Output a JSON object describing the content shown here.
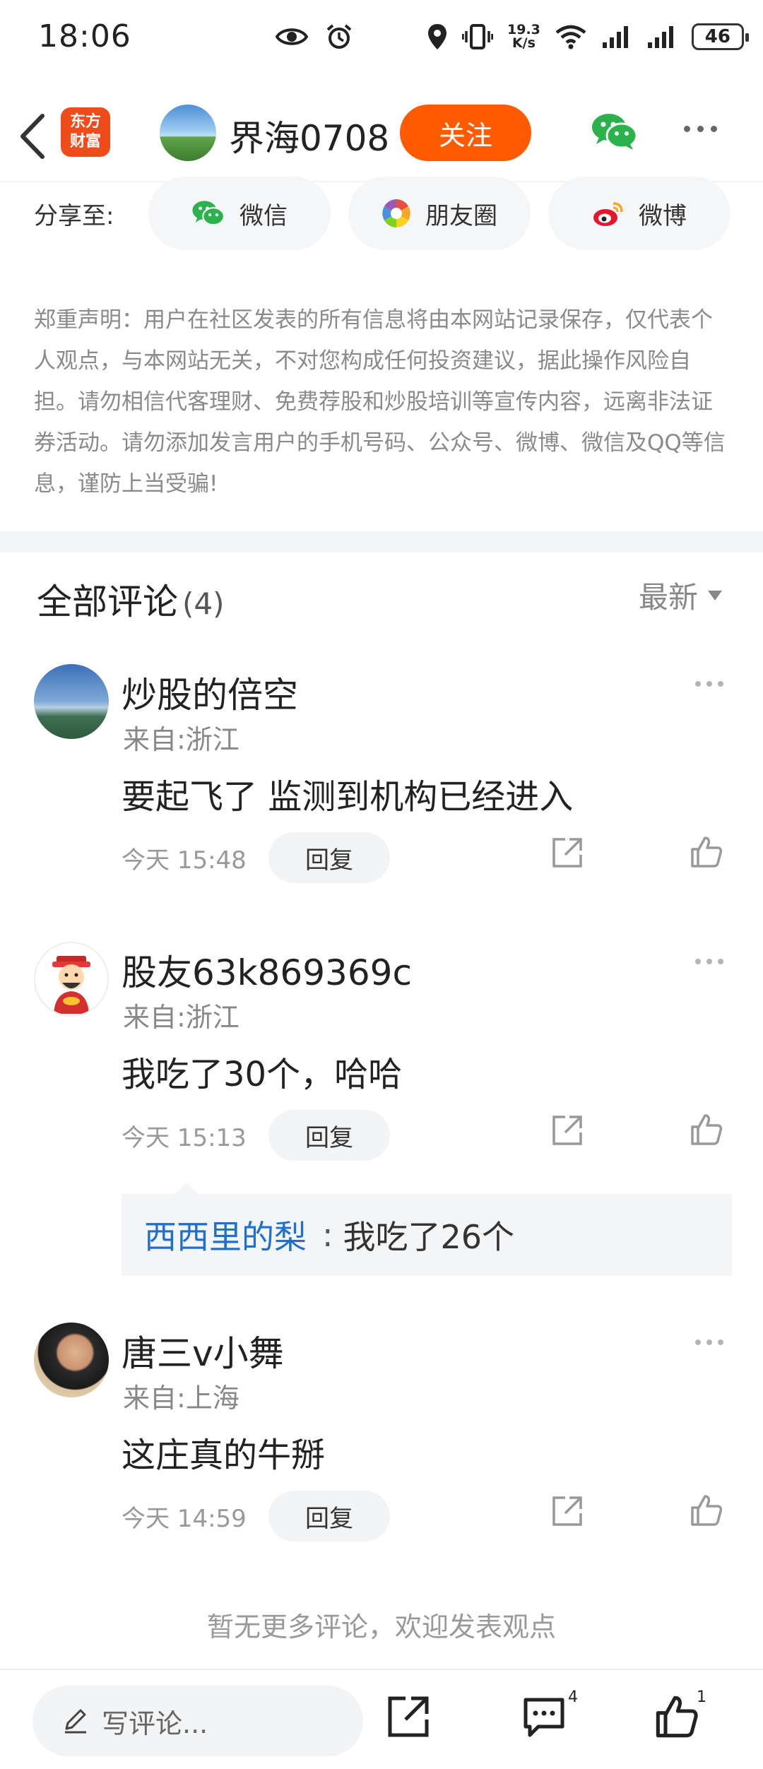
{
  "status_bar": {
    "time": "18:06",
    "net_speed_value": "19.3",
    "net_speed_unit": "K/s",
    "battery": "46"
  },
  "header": {
    "app_logo_line1": "东方",
    "app_logo_line2": "财富",
    "username": "界海0708",
    "follow_label": "关注"
  },
  "share": {
    "label": "分享至:",
    "options": [
      "微信",
      "朋友圈",
      "微博"
    ]
  },
  "disclaimer": "郑重声明：用户在社区发表的所有信息将由本网站记录保存，仅代表个人观点，与本网站无关，不对您构成任何投资建议，据此操作风险自担。请勿相信代客理财、免费荐股和炒股培训等宣传内容，远离非法证券活动。请勿添加发言用户的手机号码、公众号、微博、微信及QQ等信息，谨防上当受骗!",
  "comments_header": {
    "title": "全部评论",
    "count": "(4)",
    "sort_label": "最新"
  },
  "comments": [
    {
      "name": "炒股的倍空",
      "location": "来自:浙江",
      "text": "要起飞了 监测到机构已经进入",
      "time": "今天 15:48",
      "reply_label": "回复"
    },
    {
      "name": "股友63k869369c",
      "location": "来自:浙江",
      "text": "我吃了30个，哈哈",
      "time": "今天 15:13",
      "reply_label": "回复",
      "sub_reply": {
        "name": "西西里的梨",
        "separator": ":",
        "text": "我吃了26个"
      }
    },
    {
      "name": "唐三v小舞",
      "location": "来自:上海",
      "text": "这庄真的牛掰",
      "time": "今天 14:59",
      "reply_label": "回复"
    }
  ],
  "end_text": "暂无更多评论，欢迎发表观点",
  "bottom_bar": {
    "comment_placeholder": "写评论...",
    "comment_count": "4",
    "like_count": "1"
  },
  "colors": {
    "brand": "#f04b1a",
    "follow": "#ff5a00",
    "link": "#1f6fd1",
    "wechat": "#2bb24c"
  }
}
